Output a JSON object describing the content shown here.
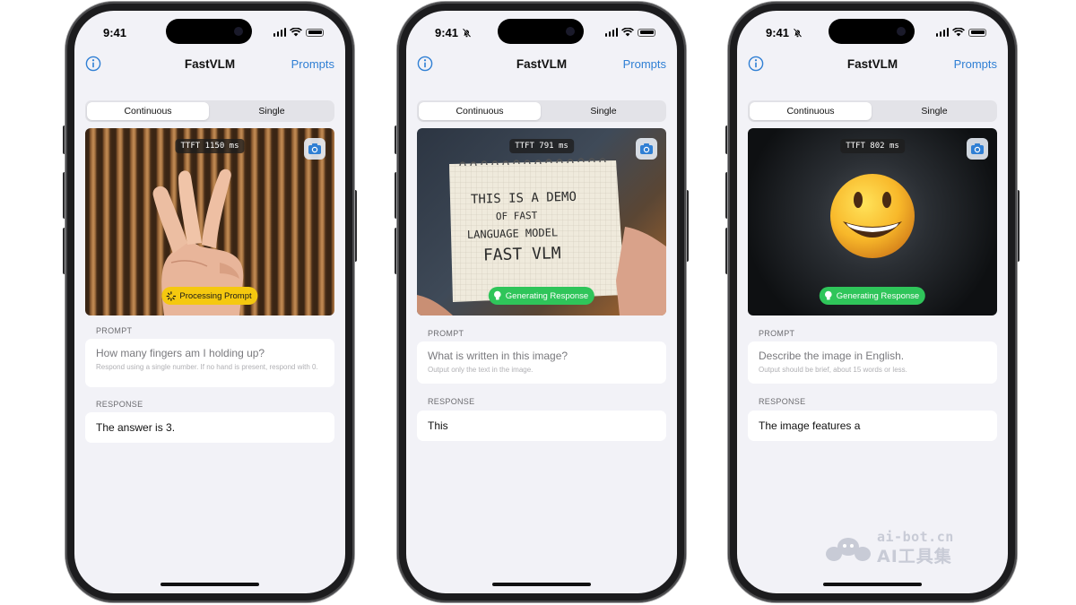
{
  "status": {
    "time": "9:41"
  },
  "nav": {
    "title": "FastVLM",
    "prompts_label": "Prompts"
  },
  "segmented": {
    "continuous": "Continuous",
    "single": "Single"
  },
  "labels": {
    "prompt": "PROMPT",
    "response": "RESPONSE"
  },
  "phones": [
    {
      "ttft": "TTFT 1150 ms",
      "badge": "Processing Prompt",
      "badge_color": "#f5c80f",
      "prompt_main": "How many fingers am I holding up?",
      "prompt_sub": "Respond using a single number. If no hand is present, respond with 0.",
      "response": "The answer is 3."
    },
    {
      "ttft": "TTFT 791 ms",
      "badge": "Generating Response",
      "badge_color": "#2fc55a",
      "note": {
        "line1": "THIS IS A DEMO",
        "line2": "OF FAST",
        "line3": "LANGUAGE MODEL",
        "line4": "FAST VLM"
      },
      "prompt_main": "What is written in this image?",
      "prompt_sub": "Output only the text in the image.",
      "response": "This"
    },
    {
      "ttft": "TTFT 802 ms",
      "badge": "Generating Response",
      "badge_color": "#2fc55a",
      "prompt_main": "Describe the image in English.",
      "prompt_sub": "Output should be brief, about 15 words or less.",
      "response": "The image features a"
    }
  ],
  "watermark": {
    "url": "ai-bot.cn",
    "name": "AI工具集"
  },
  "colors": {
    "accent": "#2f7fd4",
    "background": "#f2f2f7",
    "frame": "#1c1c1e"
  }
}
